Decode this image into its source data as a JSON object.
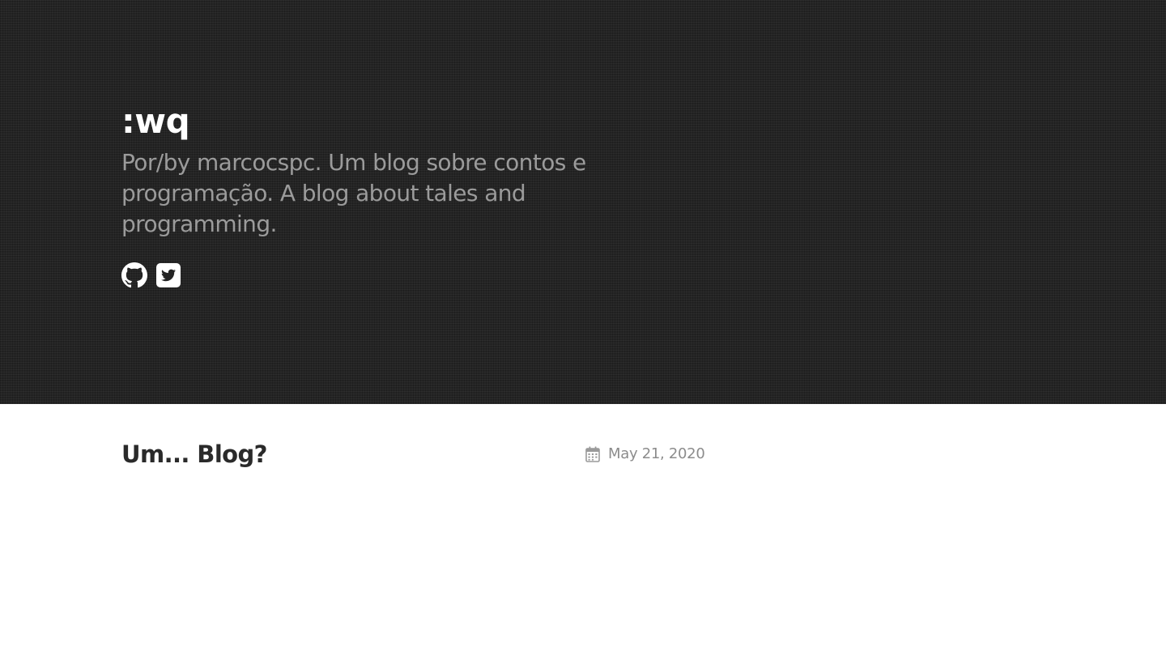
{
  "header": {
    "title": ":wq",
    "description": "Por/by marcocspc. Um blog sobre contos e programação. A blog about tales and programming.",
    "social": [
      {
        "icon": "github-icon"
      },
      {
        "icon": "twitter-icon"
      }
    ]
  },
  "posts": [
    {
      "title": "Um... Blog?",
      "date": "May 21, 2020",
      "icon": "calendar-icon"
    }
  ],
  "colors": {
    "hero_background": "#242424",
    "title": "#ffffff",
    "description": "#9b9b9b",
    "post_title": "#2a2a2a",
    "post_date": "#8c8c8c"
  }
}
